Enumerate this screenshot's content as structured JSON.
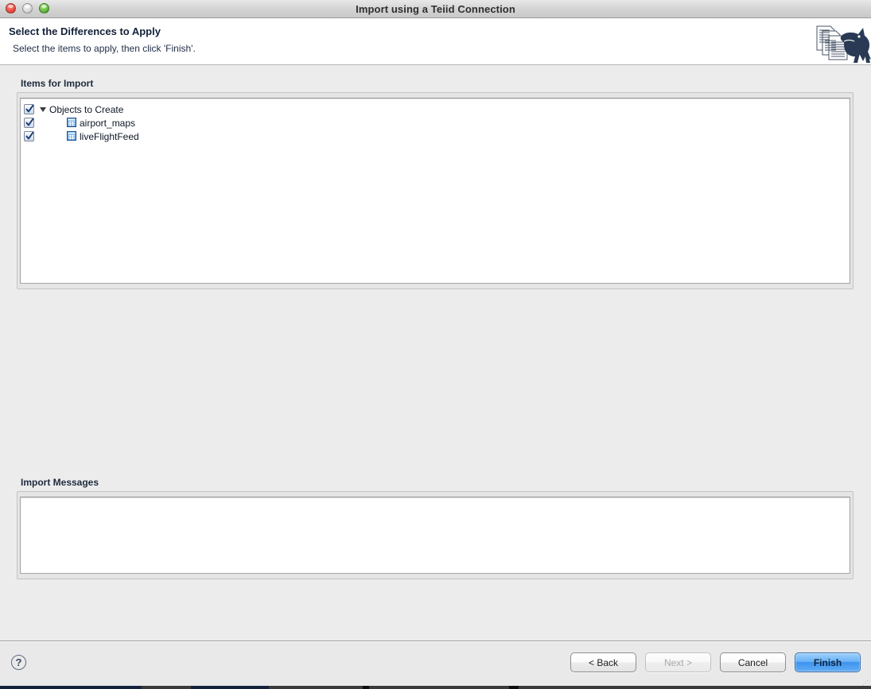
{
  "window": {
    "title": "Import using a Teiid Connection",
    "traffic_lights": [
      "close-button",
      "minimize-button",
      "zoom-button"
    ]
  },
  "banner": {
    "title": "Select the Differences to Apply",
    "subtitle": "Select the items to apply, then click 'Finish'.",
    "logo_icon": "teiid-dinosaur-documents-icon"
  },
  "sections": {
    "items_for_import": {
      "label": "Items for Import",
      "tree": [
        {
          "label": "Objects to Create",
          "depth": 0,
          "checked": true,
          "expanded": true,
          "twisty": "triangle-down-icon",
          "icon": null
        },
        {
          "label": "airport_maps",
          "depth": 1,
          "checked": true,
          "expanded": null,
          "twisty": null,
          "icon": "table-icon"
        },
        {
          "label": "liveFlightFeed",
          "depth": 1,
          "checked": true,
          "expanded": null,
          "twisty": null,
          "icon": "table-icon"
        }
      ]
    },
    "import_messages": {
      "label": "Import Messages",
      "value": ""
    }
  },
  "footer": {
    "help_label": "?",
    "buttons": [
      {
        "label": "< Back",
        "name": "back-button",
        "state": "enabled"
      },
      {
        "label": "Next >",
        "name": "next-button",
        "state": "disabled"
      },
      {
        "label": "Cancel",
        "name": "cancel-button",
        "state": "enabled"
      },
      {
        "label": "Finish",
        "name": "finish-button",
        "state": "default"
      }
    ]
  },
  "colors": {
    "accent": "#3d93ee",
    "window_bg": "#ececec",
    "panel_bg": "#ffffff",
    "icon_blue": "#3c7fd0"
  }
}
